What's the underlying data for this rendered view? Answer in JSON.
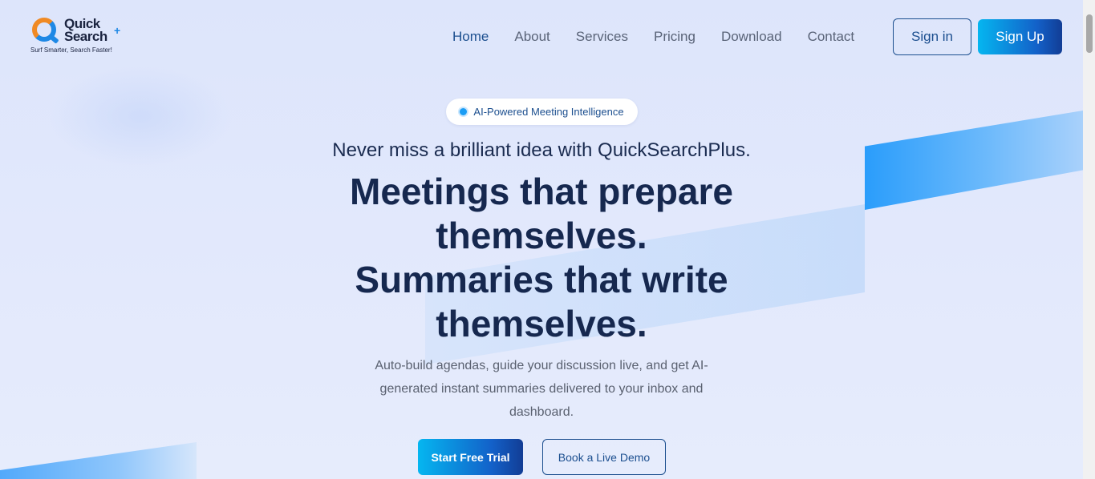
{
  "brand": {
    "name_line1": "Quick",
    "name_line2": "Search",
    "plus": "+",
    "tagline": "Surf Smarter, Search Faster!"
  },
  "nav": {
    "items": [
      "Home",
      "About",
      "Services",
      "Pricing",
      "Download",
      "Contact"
    ],
    "active": "Home"
  },
  "auth": {
    "signin_label": "Sign in",
    "signup_label": "Sign Up"
  },
  "hero": {
    "badge": "AI-Powered Meeting Intelligence",
    "tagline": "Never miss a brilliant idea with QuickSearchPlus.",
    "headline_line1": "Meetings that prepare",
    "headline_line2": "themselves.",
    "headline_line3": "Summaries that write",
    "headline_line4": "themselves.",
    "description": "Auto-build agendas, guide your discussion live, and get AI-generated instant summaries delivered to your inbox and dashboard.",
    "cta_primary": "Start Free Trial",
    "cta_secondary": "Book a Live Demo"
  },
  "colors": {
    "accent": "#1c4f8f",
    "cta_gradient_start": "#05b6f0",
    "cta_gradient_end": "#123d95"
  }
}
